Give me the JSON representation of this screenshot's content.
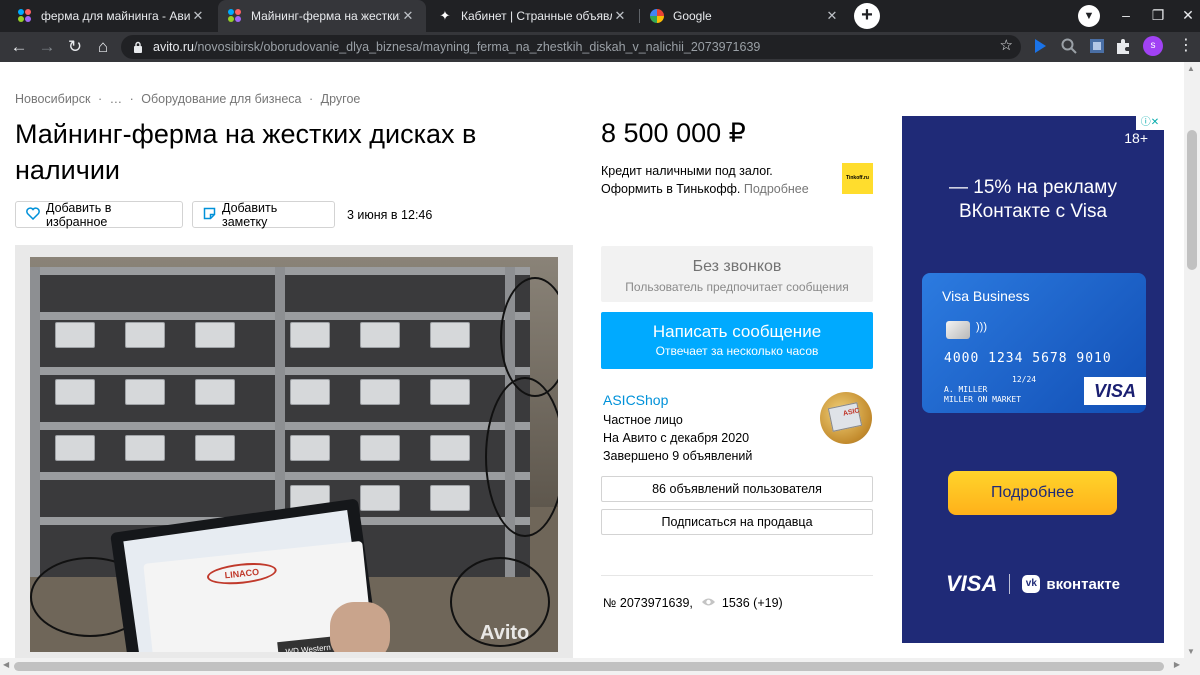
{
  "tabs": [
    {
      "title": "ферма для майнинга - Авито | ОБ…"
    },
    {
      "title": "Майнинг-ферма на жестких дис…"
    },
    {
      "title": "Кабинет | Странные объявлени…"
    },
    {
      "title": "Google"
    }
  ],
  "address": {
    "host": "avito.ru",
    "path": "/novosibirsk/oborudovanie_dlya_biznesa/mayning_ferma_na_zhestkih_diskah_v_nalichii_2073971639"
  },
  "profile_initial": "s",
  "breadcrumb": [
    "Новосибирск",
    "·",
    "…",
    "·",
    "Оборудование для бизнеса",
    "·",
    "Другое"
  ],
  "listing": {
    "title": "Майнинг-ферма на жестких дисках в наличии",
    "favorite_label": "Добавить в избранное",
    "note_label": "Добавить заметку",
    "posted": "3 июня в 12:46",
    "price": "8 500 000 ₽",
    "credit_line1": "Кредит наличными под залог.",
    "credit_line2": "Оформить в Тинькофф.",
    "credit_more": "Подробнее",
    "tinkoff_logo": "Tinkoff.ru",
    "no_calls_title": "Без звонков",
    "no_calls_sub": "Пользователь предпочитает сообщения",
    "write_title": "Написать сообщение",
    "write_sub": "Отвечает за несколько часов",
    "photo_watermark": "Avito",
    "photo_box_logo": "LINACO",
    "photo_box_brand": "WD Western Digital",
    "id_text": "№ 2073971639,",
    "views": "1536 (+19)"
  },
  "seller": {
    "name": "ASICShop",
    "type": "Частное лицо",
    "since": "На Авито с декабря 2020",
    "completed": "Завершено 9 объявлений",
    "avatar_label": "ASIC",
    "ads_button": "86 объявлений пользователя",
    "subscribe_button": "Подписаться на продавца"
  },
  "ad": {
    "age": "18+",
    "headline": "— 15% на рекламу ВКонтакте с Visa",
    "card_title": "Visa Business",
    "card_number": "4000 1234 5678 9010",
    "card_expiry": "12/24",
    "card_holder_line1": "A. MILLER",
    "card_holder_line2": "MILLER ON MARKET",
    "card_logo": "VISA",
    "cta": "Подробнее",
    "brand_visa": "VISA",
    "brand_vk": "вконтакте"
  },
  "colors": {
    "accent_blue": "#00aaff",
    "link_blue": "#0091d9",
    "ad_background": "#1f2a77",
    "cta_yellow": "#ffc21f"
  }
}
